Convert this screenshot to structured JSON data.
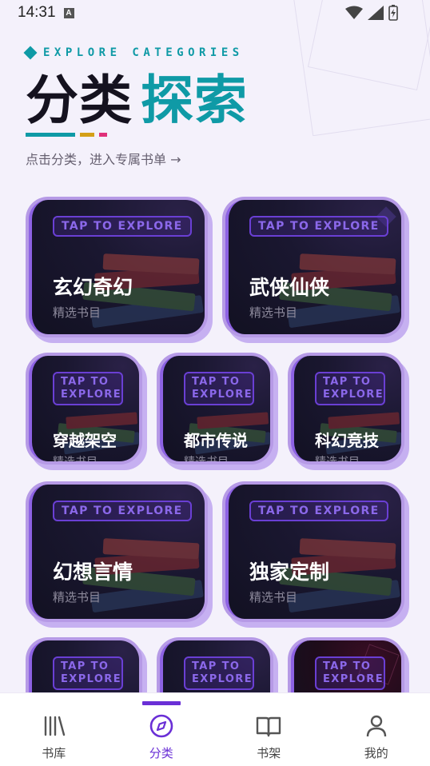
{
  "status_bar": {
    "time": "14:31"
  },
  "header": {
    "eyebrow": "EXPLORE CATEGORIES",
    "title_part1": "分类",
    "title_part2": "探索",
    "subtitle": "点击分类，进入专属书单 →"
  },
  "colors": {
    "accent_teal": "#0f9aa6",
    "accent_gold": "#d4a017",
    "accent_pink": "#e0317a",
    "primary_purple": "#6a2fd6"
  },
  "categories": [
    {
      "tag": "TAP TO EXPLORE",
      "title": "玄幻奇幻",
      "subtitle": "精选书目"
    },
    {
      "tag": "TAP TO EXPLORE",
      "title": "武侠仙侠",
      "subtitle": "精选书目"
    },
    {
      "tag": "TAP TO EXPLORE",
      "title": "穿越架空",
      "subtitle": "精选书目"
    },
    {
      "tag": "TAP TO EXPLORE",
      "title": "都市传说",
      "subtitle": "精选书目"
    },
    {
      "tag": "TAP TO EXPLORE",
      "title": "科幻竞技",
      "subtitle": "精选书目"
    },
    {
      "tag": "TAP TO EXPLORE",
      "title": "幻想言情",
      "subtitle": "精选书目"
    },
    {
      "tag": "TAP TO EXPLORE",
      "title": "独家定制",
      "subtitle": "精选书目"
    },
    {
      "tag": "TAP TO EXPLORE"
    },
    {
      "tag": "TAP TO EXPLORE"
    },
    {
      "tag": "TAP TO EXPLORE"
    }
  ],
  "bottom_nav": [
    {
      "label": "书库",
      "icon": "library-icon"
    },
    {
      "label": "分类",
      "icon": "compass-icon",
      "active": true
    },
    {
      "label": "书架",
      "icon": "book-open-icon"
    },
    {
      "label": "我的",
      "icon": "user-icon"
    }
  ]
}
